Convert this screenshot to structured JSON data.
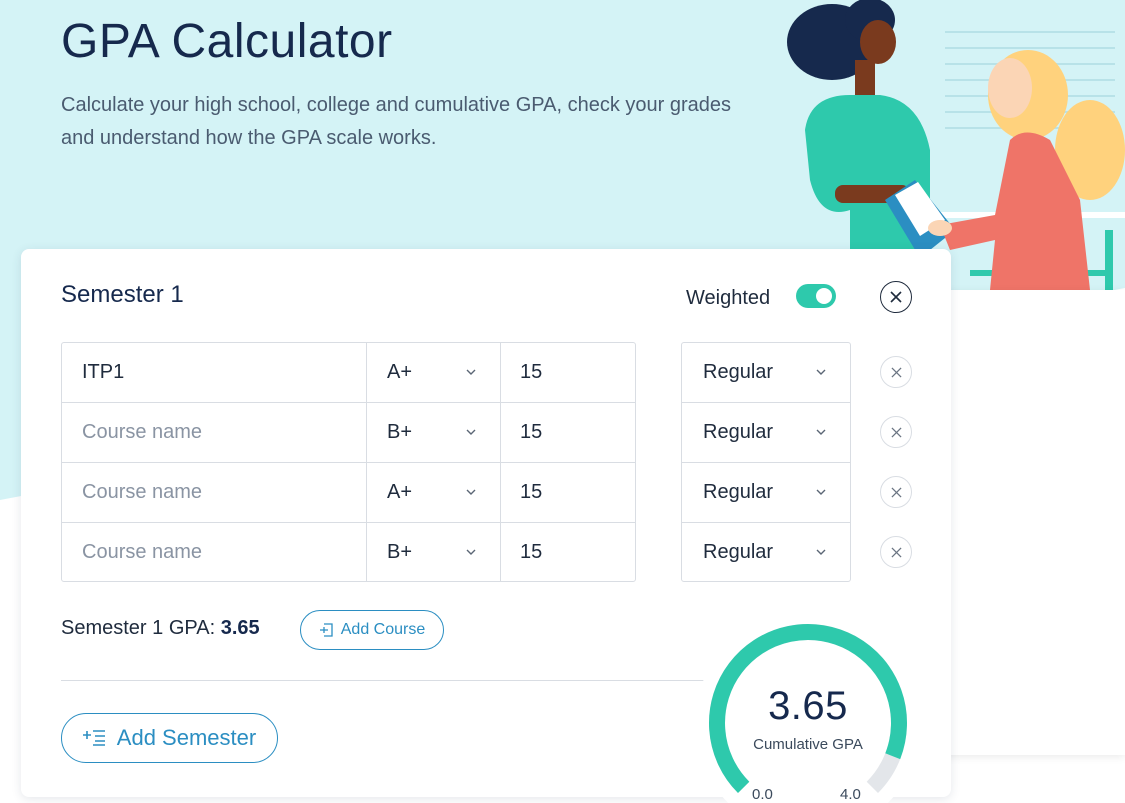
{
  "header": {
    "title": "GPA Calculator",
    "subtitle": "Calculate your high school, college and cumulative GPA, check your grades and understand how the GPA scale works."
  },
  "semester": {
    "title": "Semester 1",
    "weighted_label": "Weighted",
    "weighted_on": true,
    "courses": [
      {
        "name": "ITP1",
        "placeholder": "Course name",
        "grade": "A+",
        "credits": "15",
        "type": "Regular"
      },
      {
        "name": "",
        "placeholder": "Course name",
        "grade": "B+",
        "credits": "15",
        "type": "Regular"
      },
      {
        "name": "",
        "placeholder": "Course name",
        "grade": "A+",
        "credits": "15",
        "type": "Regular"
      },
      {
        "name": "",
        "placeholder": "Course name",
        "grade": "B+",
        "credits": "15",
        "type": "Regular"
      }
    ],
    "gpa_label": "Semester 1 GPA:",
    "gpa_value": "3.65",
    "add_course_label": "Add Course"
  },
  "add_semester_label": "Add Semester",
  "cumulative": {
    "value": "3.65",
    "label": "Cumulative GPA",
    "min": "0.0",
    "max": "4.0",
    "fill_fraction": 0.9125
  },
  "colors": {
    "accent": "#2ec9ac",
    "link": "#2b8ec2",
    "hero_bg": "#d4f3f6",
    "title": "#16294d"
  }
}
